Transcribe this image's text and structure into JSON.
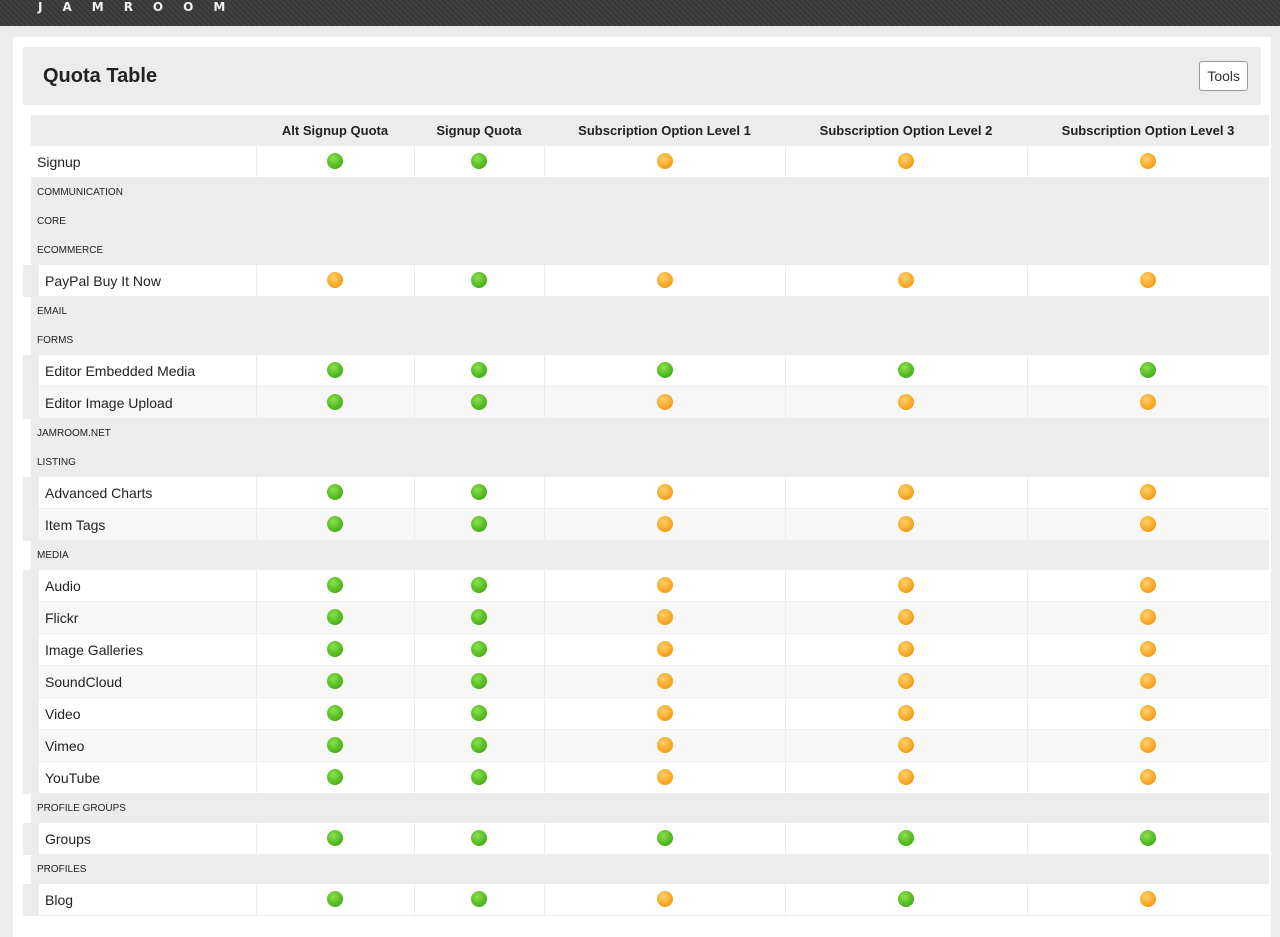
{
  "app": {
    "logo": "JAMROOM"
  },
  "header": {
    "title": "Quota Table",
    "tools_label": "Tools"
  },
  "columns": [
    "",
    "Alt Signup Quota",
    "Signup Quota",
    "Subscription Option Level 1",
    "Subscription Option Level 2",
    "Subscription Option Level 3"
  ],
  "status_colors": {
    "active": "#4fb81f",
    "inactive": "#f6a623"
  },
  "rows": [
    {
      "type": "item",
      "label": "Signup",
      "indent": false,
      "values": [
        "active",
        "active",
        "inactive",
        "inactive",
        "inactive"
      ]
    },
    {
      "type": "section",
      "label": "Communication"
    },
    {
      "type": "section",
      "label": "Core"
    },
    {
      "type": "section",
      "label": "eCommerce"
    },
    {
      "type": "item",
      "label": "PayPal Buy It Now",
      "indent": true,
      "values": [
        "inactive",
        "active",
        "inactive",
        "inactive",
        "inactive"
      ]
    },
    {
      "type": "section",
      "label": "Email"
    },
    {
      "type": "section",
      "label": "Forms"
    },
    {
      "type": "item",
      "label": "Editor Embedded Media",
      "indent": true,
      "values": [
        "active",
        "active",
        "active",
        "active",
        "active"
      ]
    },
    {
      "type": "item",
      "label": "Editor Image Upload",
      "indent": true,
      "values": [
        "active",
        "active",
        "inactive",
        "inactive",
        "inactive"
      ]
    },
    {
      "type": "section",
      "label": "Jamroom.net"
    },
    {
      "type": "section",
      "label": "Listing"
    },
    {
      "type": "item",
      "label": "Advanced Charts",
      "indent": true,
      "values": [
        "active",
        "active",
        "inactive",
        "inactive",
        "inactive"
      ]
    },
    {
      "type": "item",
      "label": "Item Tags",
      "indent": true,
      "values": [
        "active",
        "active",
        "inactive",
        "inactive",
        "inactive"
      ]
    },
    {
      "type": "section",
      "label": "Media"
    },
    {
      "type": "item",
      "label": "Audio",
      "indent": true,
      "values": [
        "active",
        "active",
        "inactive",
        "inactive",
        "inactive"
      ]
    },
    {
      "type": "item",
      "label": "Flickr",
      "indent": true,
      "values": [
        "active",
        "active",
        "inactive",
        "inactive",
        "inactive"
      ]
    },
    {
      "type": "item",
      "label": "Image Galleries",
      "indent": true,
      "values": [
        "active",
        "active",
        "inactive",
        "inactive",
        "inactive"
      ]
    },
    {
      "type": "item",
      "label": "SoundCloud",
      "indent": true,
      "values": [
        "active",
        "active",
        "inactive",
        "inactive",
        "inactive"
      ]
    },
    {
      "type": "item",
      "label": "Video",
      "indent": true,
      "values": [
        "active",
        "active",
        "inactive",
        "inactive",
        "inactive"
      ]
    },
    {
      "type": "item",
      "label": "Vimeo",
      "indent": true,
      "values": [
        "active",
        "active",
        "inactive",
        "inactive",
        "inactive"
      ]
    },
    {
      "type": "item",
      "label": "YouTube",
      "indent": true,
      "values": [
        "active",
        "active",
        "inactive",
        "inactive",
        "inactive"
      ]
    },
    {
      "type": "section",
      "label": "Profile Groups"
    },
    {
      "type": "item",
      "label": "Groups",
      "indent": true,
      "values": [
        "active",
        "active",
        "active",
        "active",
        "active"
      ]
    },
    {
      "type": "section",
      "label": "Profiles"
    },
    {
      "type": "item",
      "label": "Blog",
      "indent": true,
      "values": [
        "active",
        "active",
        "inactive",
        "active",
        "inactive"
      ]
    }
  ]
}
